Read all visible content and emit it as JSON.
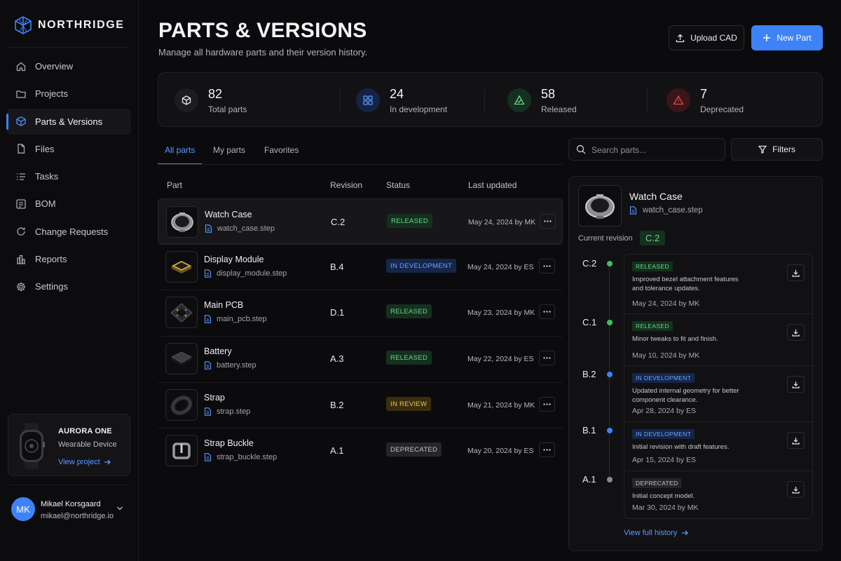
{
  "brand": {
    "name": "NORTHRIDGE",
    "logo_icon": "cube-logo-icon"
  },
  "colors": {
    "accent": "#3e82f7",
    "released": "#6fd48c",
    "development": "#6ea4ff",
    "review": "#f2c14e",
    "deprecated": "#c4c4c8",
    "danger": "#e5484d"
  },
  "sidebar": {
    "items": [
      {
        "label": "Overview",
        "icon": "home-icon",
        "active": false
      },
      {
        "label": "Projects",
        "icon": "folder-icon",
        "active": false
      },
      {
        "label": "Parts & Versions",
        "icon": "cube-icon",
        "active": true
      },
      {
        "label": "Files",
        "icon": "file-icon",
        "active": false
      },
      {
        "label": "Tasks",
        "icon": "checklist-icon",
        "active": false
      },
      {
        "label": "BOM",
        "icon": "bom-icon",
        "active": false
      },
      {
        "label": "Change Requests",
        "icon": "change-request-icon",
        "active": false
      },
      {
        "label": "Reports",
        "icon": "reports-icon",
        "active": false
      },
      {
        "label": "Settings",
        "icon": "gear-icon",
        "active": false
      }
    ],
    "project": {
      "name": "AURORA ONE",
      "type": "Wearable Device",
      "link": "View project"
    },
    "user": {
      "initials": "MK",
      "name": "Mikael Korsgaard",
      "email": "mikael@northridge.io"
    }
  },
  "header": {
    "title": "PARTS & VERSIONS",
    "subtitle": "Manage all hardware parts and their version history.",
    "upload_label": "Upload CAD",
    "new_label": "New Part"
  },
  "stats": [
    {
      "value": "82",
      "label": "Total parts",
      "icon": "box-icon"
    },
    {
      "value": "24",
      "label": "In development",
      "icon": "grid-icon"
    },
    {
      "value": "58",
      "label": "Released",
      "icon": "check-triangle-icon"
    },
    {
      "value": "7",
      "label": "Deprecated",
      "icon": "alert-icon"
    }
  ],
  "tabs": [
    "All parts",
    "My parts",
    "Favorites"
  ],
  "search": {
    "placeholder": "Search parts..."
  },
  "filters_label": "Filters",
  "table": {
    "headers": {
      "part": "Part",
      "revision": "Revision",
      "status": "Status",
      "updated": "Last updated"
    },
    "rows": [
      {
        "name": "Watch Case",
        "file": "watch_case.step",
        "revision": "C.2",
        "status": "RELEASED",
        "status_kind": "released",
        "updated": "May 24, 2024 by MK"
      },
      {
        "name": "Display Module",
        "file": "display_module.step",
        "revision": "B.4",
        "status": "IN DEVELOPMENT",
        "status_kind": "dev",
        "updated": "May 24, 2024 by ES"
      },
      {
        "name": "Main PCB",
        "file": "main_pcb.step",
        "revision": "D.1",
        "status": "RELEASED",
        "status_kind": "released",
        "updated": "May 23, 2024 by MK"
      },
      {
        "name": "Battery",
        "file": "battery.step",
        "revision": "A.3",
        "status": "RELEASED",
        "status_kind": "released",
        "updated": "May 22, 2024 by ES"
      },
      {
        "name": "Strap",
        "file": "strap.step",
        "revision": "B.2",
        "status": "IN REVIEW",
        "status_kind": "review",
        "updated": "May 21, 2024 by MK"
      },
      {
        "name": "Strap Buckle",
        "file": "strap_buckle.step",
        "revision": "A.1",
        "status": "DEPRECATED",
        "status_kind": "dep",
        "updated": "May 20, 2024 by ES"
      }
    ]
  },
  "detail": {
    "name": "Watch Case",
    "file": "watch_case.step",
    "current_label": "Current revision",
    "current_value": "C.2",
    "history": [
      {
        "rev": "C.2",
        "status": "RELEASED",
        "status_kind": "released",
        "desc": "Improved bezel attachment features and tolerance updates.",
        "date": "May 24, 2024 by MK"
      },
      {
        "rev": "C.1",
        "status": "RELEASED",
        "status_kind": "released",
        "desc": "Minor tweaks to fit and finish.",
        "date": "May 10, 2024 by MK"
      },
      {
        "rev": "B.2",
        "status": "IN DEVELOPMENT",
        "status_kind": "dev",
        "desc": "Updated internal geometry for better component clearance.",
        "date": "Apr 28, 2024 by ES"
      },
      {
        "rev": "B.1",
        "status": "IN DEVELOPMENT",
        "status_kind": "dev",
        "desc": "Initial revision with draft features.",
        "date": "Apr 15, 2024 by ES"
      },
      {
        "rev": "A.1",
        "status": "DEPRECATED",
        "status_kind": "dep",
        "desc": "Initial concept model.",
        "date": "Mar 30, 2024 by MK"
      }
    ],
    "view_history": "View full history"
  }
}
